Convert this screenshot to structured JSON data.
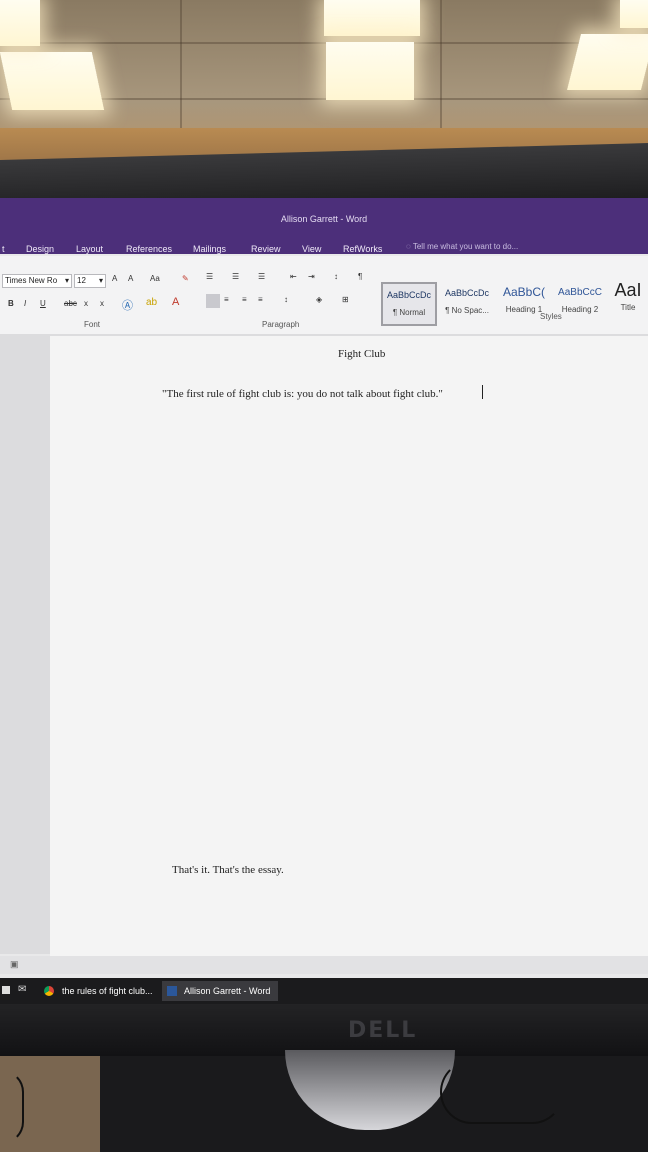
{
  "window": {
    "title": "Allison Garrett - Word"
  },
  "ribbon_tabs": [
    "t",
    "Design",
    "Layout",
    "References",
    "Mailings",
    "Review",
    "View",
    "RefWorks"
  ],
  "tell_me": "Tell me what you want to do...",
  "font": {
    "name": "Times New Ro",
    "size": "12",
    "grow": "A",
    "shrink": "A",
    "case": "Aa",
    "group_label": "Font"
  },
  "format_buttons": {
    "bold": "B",
    "italic": "I",
    "underline": "U",
    "strike": "abc",
    "sub": "x",
    "sup": "x"
  },
  "paragraph": {
    "group_label": "Paragraph",
    "pilcrow": "¶"
  },
  "styles": {
    "group_label": "Styles",
    "items": [
      {
        "sample": "AaBbCcDc",
        "name": "¶ Normal"
      },
      {
        "sample": "AaBbCcDc",
        "name": "¶ No Spac..."
      },
      {
        "sample": "AaBbC(",
        "name": "Heading 1"
      },
      {
        "sample": "AaBbCcC",
        "name": "Heading 2"
      },
      {
        "sample": "AaI",
        "name": "Title"
      }
    ]
  },
  "document": {
    "title": "Fight Club",
    "quote": "\"The first rule of fight club is: you do not talk about fight club.\"",
    "closing": "That's it. That's the essay."
  },
  "taskbar": {
    "items": [
      {
        "label": "the rules of fight club..."
      },
      {
        "label": "Allison Garrett - Word"
      }
    ]
  },
  "monitor": {
    "brand": "DELL"
  },
  "colors": {
    "word_purple": "#4c2f7a",
    "taskbar": "#1b1b1d"
  }
}
